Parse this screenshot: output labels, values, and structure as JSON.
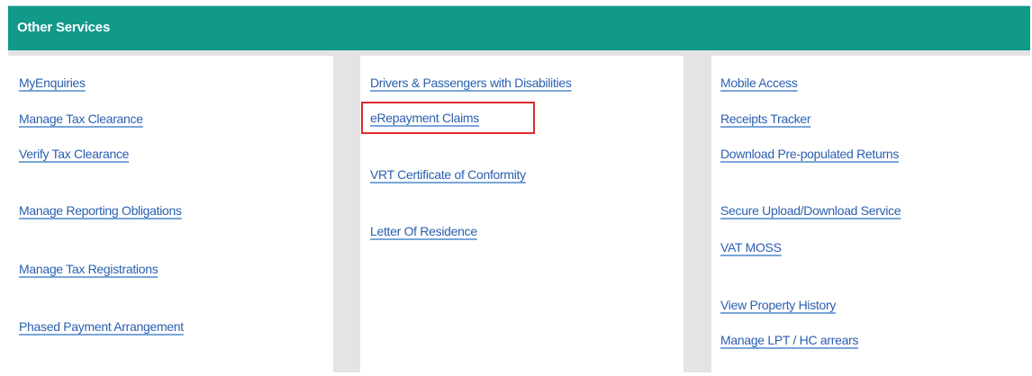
{
  "header": {
    "title": "Other Services"
  },
  "columns": [
    {
      "links": [
        "MyEnquiries",
        "Manage Tax Clearance",
        "Verify Tax Clearance",
        "Manage Reporting Obligations",
        "Manage Tax Registrations",
        "Phased Payment Arrangement"
      ]
    },
    {
      "links": [
        "Drivers & Passengers with Disabilities",
        "eRepayment Claims",
        "VRT Certificate of Conformity",
        "Letter Of Residence"
      ]
    },
    {
      "links": [
        "Mobile Access",
        "Receipts Tracker",
        "Download Pre-populated Returns",
        "Secure Upload/Download Service",
        "VAT MOSS",
        "View Property History",
        "Manage LPT / HC arrears"
      ]
    }
  ],
  "colors": {
    "header_bg": "#11998a",
    "link": "#2a5fb0",
    "highlight": "#e02a2a"
  }
}
